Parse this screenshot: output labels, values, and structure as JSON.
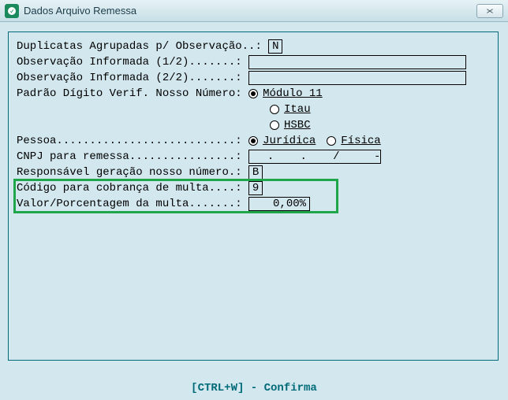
{
  "titlebar": {
    "title": "Dados Arquivo Remessa"
  },
  "form": {
    "duplicatas_label": "Duplicatas Agrupadas p/ Observação..: ",
    "duplicatas_value": "N",
    "obs1_label": "Observação Informada (1/2).......: ",
    "obs1_value": "",
    "obs2_label": "Observação Informada (2/2).......: ",
    "obs2_value": "",
    "padrao_label": "Padrão Dígito Verif. Nosso Número: ",
    "padrao_options": {
      "modulo11": "Módulo 11",
      "itau": "Itau",
      "hsbc": "HSBC"
    },
    "pessoa_label": "Pessoa...........................: ",
    "pessoa_options": {
      "juridica": "Jurídica",
      "fisica": "Física"
    },
    "cnpj_label": "CNPJ para remessa................: ",
    "cnpj_value": "  .   .   /    -  ",
    "resp_label": "Responsável geração nosso número.: ",
    "resp_value": "B",
    "codigo_multa_label": "Código para cobrança de multa....: ",
    "codigo_multa_value": "9",
    "valor_multa_label": "Valor/Porcentagem da multa.......: ",
    "valor_multa_value": "0,00%"
  },
  "footer": {
    "confirm": "[CTRL+W] - Confirma"
  }
}
